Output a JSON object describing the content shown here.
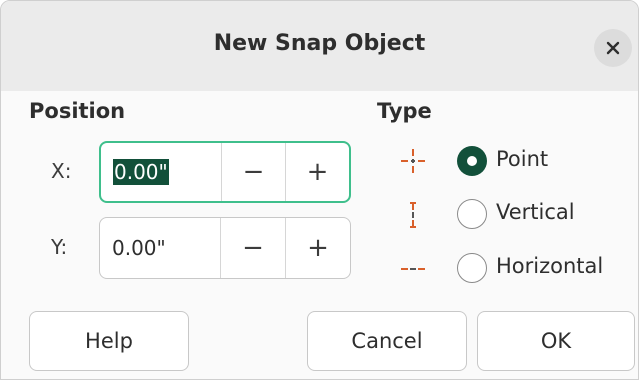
{
  "dialog": {
    "title": "New Snap Object"
  },
  "position": {
    "heading": "Position",
    "x": {
      "label": "X:",
      "value": "0.00\""
    },
    "y": {
      "label": "Y:",
      "value": "0.00\""
    },
    "decrement_label": "−",
    "increment_label": "+"
  },
  "type": {
    "heading": "Type",
    "options": [
      {
        "label": "Point",
        "checked": true,
        "icon": "snap-point-icon"
      },
      {
        "label": "Vertical",
        "checked": false,
        "icon": "snap-vertical-icon"
      },
      {
        "label": "Horizontal",
        "checked": false,
        "icon": "snap-horizontal-icon"
      }
    ]
  },
  "buttons": {
    "help": "Help",
    "cancel": "Cancel",
    "ok": "OK"
  },
  "colors": {
    "accent": "#12503a",
    "focus": "#3fbf8c",
    "snap_icon": "#d9602b"
  }
}
